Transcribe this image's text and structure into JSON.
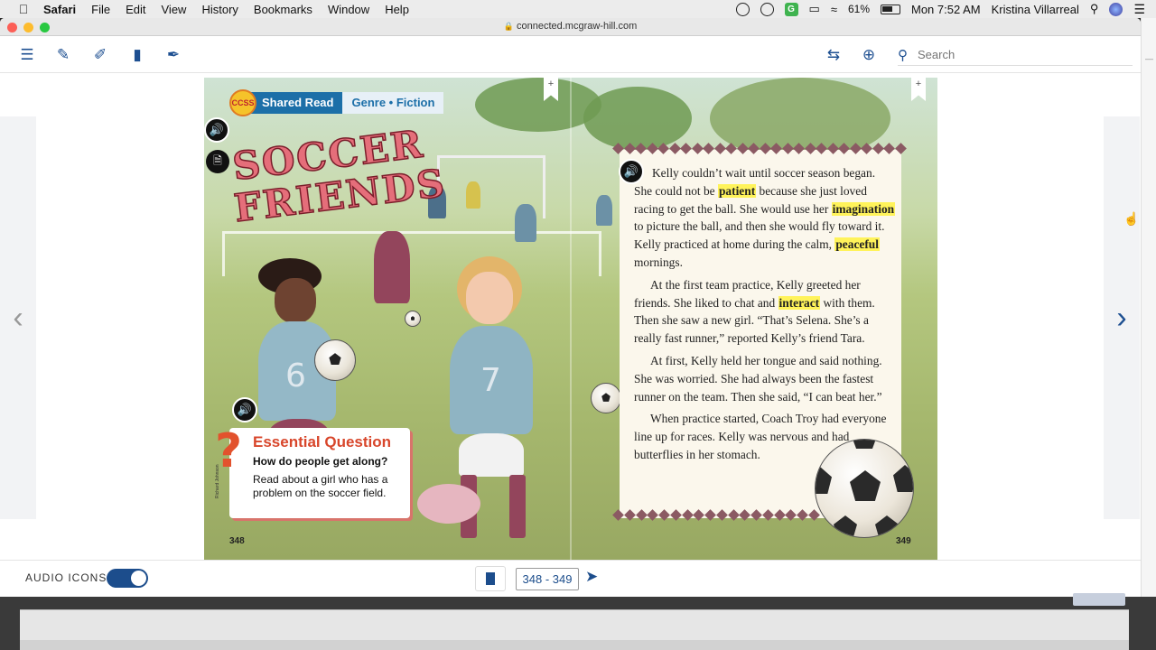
{
  "menubar": {
    "app_name": "Safari",
    "menus": [
      "File",
      "Edit",
      "View",
      "History",
      "Bookmarks",
      "Window",
      "Help"
    ],
    "battery": "61%",
    "clock": "Mon 7:52 AM",
    "user": "Kristina Villarreal"
  },
  "browser": {
    "url": "connected.mcgraw-hill.com"
  },
  "toolbar": {
    "search_placeholder": "Search"
  },
  "book": {
    "badge": "CCSS",
    "shared_read": "Shared Read",
    "genre": "Genre • Fiction",
    "title_line1": "SOCCER",
    "title_line2": "FRIENDS",
    "essential_question": {
      "heading": "Essential Question",
      "question": "How do people get along?",
      "prompt": "Read about a girl who has a problem on the soccer field."
    },
    "credit": "Richard Johnson",
    "jersey_left": "6",
    "jersey_right": "7",
    "page_left": "348",
    "page_right": "349",
    "paragraphs": [
      {
        "parts": [
          {
            "text": "Kelly couldn’t wait until soccer season began. She could not be ",
            "hl": false
          },
          {
            "text": "patient",
            "hl": true
          },
          {
            "text": " because she just loved racing to get the ball. She would use her ",
            "hl": false
          },
          {
            "text": "imagination",
            "hl": true
          },
          {
            "text": " to picture the ball, and then she would fly toward it. Kelly practiced at home during the calm, ",
            "hl": false
          },
          {
            "text": "peaceful",
            "hl": true
          },
          {
            "text": " mornings.",
            "hl": false
          }
        ]
      },
      {
        "parts": [
          {
            "text": "At the first team practice, Kelly greeted her friends. She liked to chat and ",
            "hl": false
          },
          {
            "text": "interact",
            "hl": true
          },
          {
            "text": " with them. Then she saw a new girl. “That’s Selena. She’s a really fast runner,” reported Kelly’s friend Tara.",
            "hl": false
          }
        ]
      },
      {
        "parts": [
          {
            "text": "At first, Kelly held her tongue and said nothing. She was worried. She had always been the fastest runner on the team. Then she said, “I can beat her.”",
            "hl": false
          }
        ]
      },
      {
        "parts": [
          {
            "text": "When practice started, Coach Troy had everyone line up for races. Kelly was nervous and had butterflies in her stomach.",
            "hl": false
          }
        ]
      }
    ]
  },
  "bottombar": {
    "audio_icons_label": "AUDIO ICONS:",
    "audio_icons_on": true,
    "page_range": "348 - 349"
  }
}
